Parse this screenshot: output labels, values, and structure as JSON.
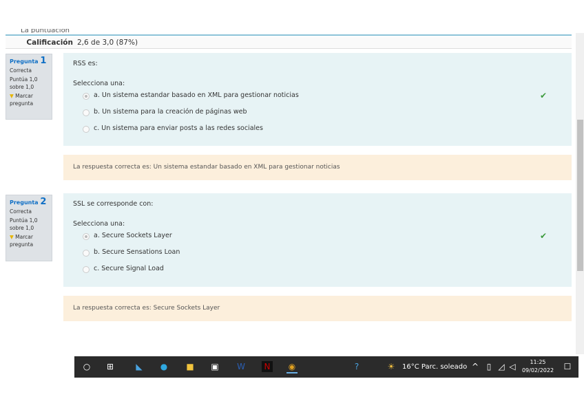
{
  "summary": {
    "cut_label": "La puntuación",
    "grade_label": "Calificación",
    "grade_value": "2,6 de 3,0 (87%)"
  },
  "questions": [
    {
      "label": "Pregunta",
      "number": "1",
      "status": "Correcta",
      "score": "Puntúa 1,0 sobre 1,0",
      "flag": "Marcar pregunta",
      "text": "RSS es:",
      "prompt": "Selecciona una:",
      "options": [
        "a. Un sistema estandar basado en XML para gestionar noticias",
        "b. Un sistema para la creación de páginas web",
        "c. Un sistema para enviar posts a las redes sociales"
      ],
      "feedback": "La respuesta correcta es: Un sistema estandar basado en XML para gestionar noticias"
    },
    {
      "label": "Pregunta",
      "number": "2",
      "status": "Correcta",
      "score": "Puntúa 1,0 sobre 1,0",
      "flag": "Marcar pregunta",
      "text": "SSL se corresponde con:",
      "prompt": "Selecciona una:",
      "options": [
        "a. Secure Sockets Layer",
        "b. Secure Sensations Loan",
        "c. Secure Signal Load"
      ],
      "feedback": "La respuesta correcta es: Secure Sockets Layer"
    }
  ],
  "taskbar": {
    "weather": "16°C  Parc. soleado",
    "time": "11:25",
    "date": "09/02/2022"
  }
}
